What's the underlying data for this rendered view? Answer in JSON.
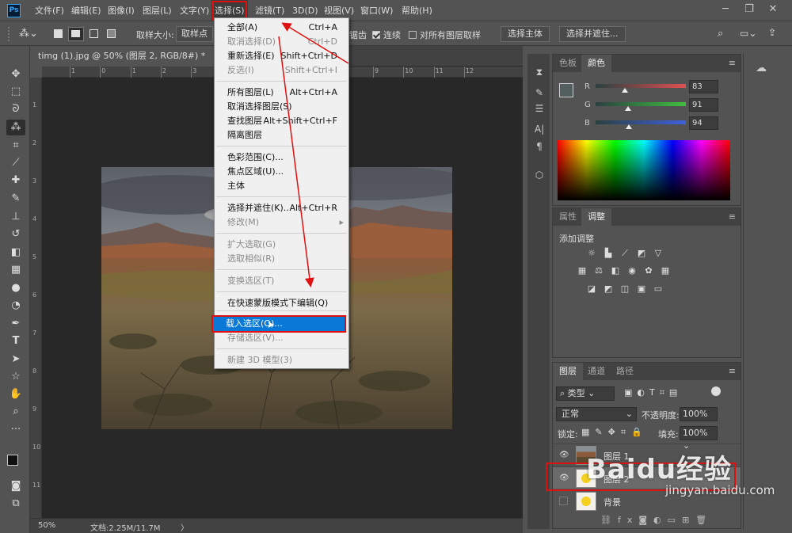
{
  "app": {
    "logo": "Ps"
  },
  "menubar": {
    "items": [
      "文件(F)",
      "编辑(E)",
      "图像(I)",
      "图层(L)",
      "文字(Y)",
      "选择(S)",
      "滤镜(T)",
      "3D(D)",
      "视图(V)",
      "窗口(W)",
      "帮助(H)"
    ],
    "active": "选择(S)",
    "window_controls": [
      "minimize-icon",
      "restore-icon",
      "close-icon"
    ]
  },
  "options_bar": {
    "sample_size_label": "取样大小:",
    "sample_size_value": "取样点",
    "anti_alias_partial": "锯齿",
    "contiguous_label": "连续",
    "contiguous_checked": true,
    "all_layers_label": "对所有图层取样",
    "all_layers_checked": false,
    "select_subject_button": "选择主体",
    "select_mask_button": "选择并遮住..."
  },
  "document": {
    "tab_title": "timg (1).jpg @ 50% (图层 2, RGB/8#) *",
    "tab_close": "×",
    "ruler_h": [
      "1",
      "0",
      "1",
      "2",
      "3",
      "4",
      "5",
      "6",
      "7",
      "8",
      "9",
      "10",
      "11",
      "12"
    ],
    "ruler_v": [
      "1",
      "2",
      "3",
      "4",
      "5",
      "6",
      "7",
      "8",
      "9",
      "10",
      "11"
    ],
    "zoom": "50%",
    "doc_info": "文档:2.25M/11.7M",
    "status_arrow": "〉"
  },
  "select_menu": {
    "items": [
      {
        "label": "全部(A)",
        "shortcut": "Ctrl+A",
        "disabled": false
      },
      {
        "label": "取消选择(D)",
        "shortcut": "Ctrl+D",
        "disabled": true
      },
      {
        "label": "重新选择(E)",
        "shortcut": "Shift+Ctrl+D",
        "disabled": false
      },
      {
        "label": "反选(I)",
        "shortcut": "Shift+Ctrl+I",
        "disabled": true
      },
      {
        "label": "所有图层(L)",
        "shortcut": "Alt+Ctrl+A",
        "disabled": false
      },
      {
        "label": "取消选择图层(S)",
        "shortcut": "",
        "disabled": false
      },
      {
        "label": "查找图层",
        "shortcut": "Alt+Shift+Ctrl+F",
        "disabled": false
      },
      {
        "label": "隔离图层",
        "shortcut": "",
        "disabled": false
      },
      {
        "label": "色彩范围(C)...",
        "shortcut": "",
        "disabled": false
      },
      {
        "label": "焦点区域(U)...",
        "shortcut": "",
        "disabled": false
      },
      {
        "label": "主体",
        "shortcut": "",
        "disabled": false
      },
      {
        "label": "选择并遮住(K)...",
        "shortcut": "Alt+Ctrl+R",
        "disabled": false
      },
      {
        "label": "修改(M)",
        "shortcut": "",
        "disabled": true,
        "submenu_arrow": "▸"
      },
      {
        "label": "扩大选取(G)",
        "shortcut": "",
        "disabled": true
      },
      {
        "label": "选取相似(R)",
        "shortcut": "",
        "disabled": true
      },
      {
        "label": "变换选区(T)",
        "shortcut": "",
        "disabled": true
      },
      {
        "label": "在快速蒙版模式下编辑(Q)",
        "shortcut": "",
        "disabled": false
      },
      {
        "label": "载入选区(O)...",
        "shortcut": "",
        "disabled": false,
        "highlighted": true
      },
      {
        "label": "存储选区(V)...",
        "shortcut": "",
        "disabled": true
      },
      {
        "label": "新建 3D 模型(3)",
        "shortcut": "",
        "disabled": true
      }
    ]
  },
  "color_panel": {
    "tabs": [
      "色板",
      "颜色"
    ],
    "active_tab": "颜色",
    "sliders": [
      {
        "label": "R",
        "value": "83",
        "color": "#e05050"
      },
      {
        "label": "G",
        "value": "91",
        "color": "#40c040"
      },
      {
        "label": "B",
        "value": "94",
        "color": "#4060e0"
      }
    ]
  },
  "adjust_panel": {
    "tabs": [
      "属性",
      "调整"
    ],
    "active_tab": "调整",
    "title": "添加调整"
  },
  "layers_panel": {
    "tabs": [
      "图层",
      "通道",
      "路径"
    ],
    "active_tab": "图层",
    "filter_label": "类型",
    "blend_mode": "正常",
    "opacity_label": "不透明度:",
    "opacity_value": "100%",
    "lock_label": "锁定:",
    "fill_label": "填充:",
    "fill_value": "100%",
    "layers": [
      {
        "name": "图层 1",
        "visible": true
      },
      {
        "name": "图层 2",
        "visible": true,
        "selected": true
      },
      {
        "name": "背景",
        "visible": false
      }
    ],
    "footer_icons": [
      "link-icon",
      "fx-icon",
      "mask-icon",
      "adjustment-icon",
      "folder-icon",
      "new-layer-icon",
      "trash-icon"
    ],
    "footer_fx": "fx"
  },
  "watermark": {
    "brand": "Baidu经验",
    "url": "jingyan.baidu.com"
  },
  "colors": {
    "accent": "#0a78d7",
    "annotation_red": "#e01010",
    "panel_bg": "#535353"
  }
}
